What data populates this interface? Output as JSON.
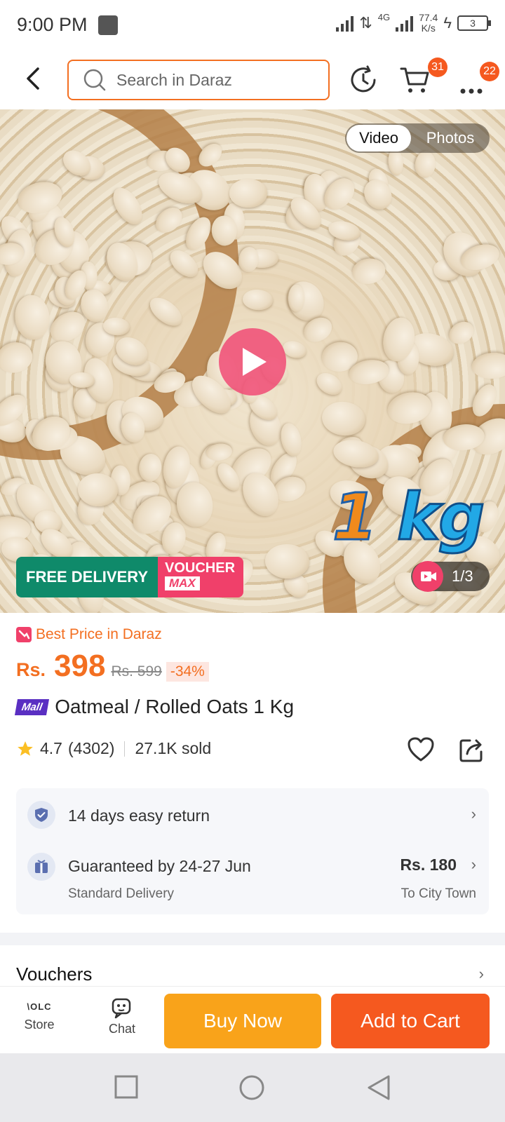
{
  "status_bar": {
    "time": "9:00 PM",
    "network_label": "4G",
    "speed_value": "77.4",
    "speed_unit": "K/s",
    "battery": "3"
  },
  "header": {
    "search_placeholder": "Search in Daraz",
    "cart_badge": "31",
    "more_badge": "22"
  },
  "gallery": {
    "toggle_video": "Video",
    "toggle_photos": "Photos",
    "overlay_text_number": "1",
    "overlay_text_unit": "kg",
    "promo_free_delivery": "FREE DELIVERY",
    "promo_voucher": "VOUCHER",
    "promo_max": "MAX",
    "counter": "1/3"
  },
  "product": {
    "best_price_label": "Best Price in Daraz",
    "currency": "Rs.",
    "price": "398",
    "old_price": "Rs. 599",
    "discount": "-34%",
    "mall_badge": "Mall",
    "title": "Oatmeal / Rolled Oats 1 Kg",
    "rating": "4.7",
    "reviews": "(4302)",
    "sold": "27.1K sold"
  },
  "info_card": {
    "return_text": "14 days easy return",
    "delivery_text": "Guaranteed by 24-27 Jun",
    "delivery_sub": "Standard Delivery",
    "delivery_fee": "Rs. 180",
    "delivery_to": "To City Town"
  },
  "vouchers": {
    "title": "Vouchers"
  },
  "action_bar": {
    "store_logo": "\\OLC",
    "store_label": "Store",
    "chat_label": "Chat",
    "buy_now": "Buy Now",
    "add_to_cart": "Add to Cart"
  },
  "colors": {
    "accent_orange": "#f5591f",
    "buy_now_yellow": "#f9a31a",
    "free_delivery_green": "#0f8a6a",
    "voucher_pink": "#f0406a",
    "mall_purple": "#5a2fc2"
  }
}
